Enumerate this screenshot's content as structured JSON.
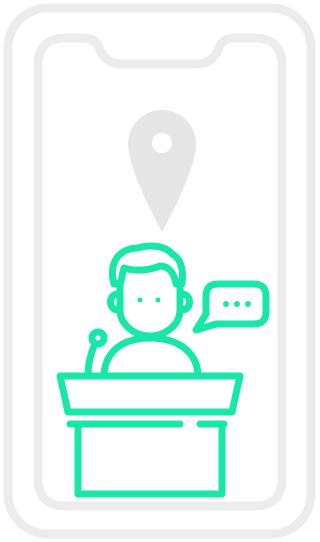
{
  "illustration": {
    "icons": [
      "smartphone-icon",
      "location-pin-icon",
      "speaker-at-podium-icon",
      "speech-bubble-icon",
      "microphone-icon"
    ],
    "colors": {
      "phone_outline": "#ececec",
      "pin": "#e6e6e6",
      "accent": "#19e6a8",
      "background": "#ffffff"
    }
  }
}
